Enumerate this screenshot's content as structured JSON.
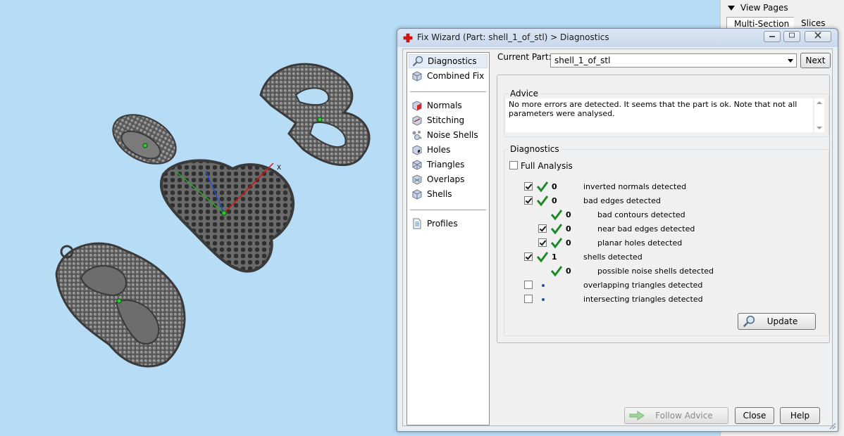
{
  "background_panel": {
    "view_pages_label": "View Pages",
    "tabs": [
      "Multi-Section",
      "Slices"
    ]
  },
  "dialog": {
    "title": "Fix Wizard (Part: shell_1_of_stl) > Diagnostics",
    "nav_items": [
      {
        "label": "Diagnostics",
        "icon": "magnifier-icon"
      },
      {
        "label": "Combined Fix",
        "icon": "cube-icon"
      },
      {
        "label": "Normals",
        "icon": "normals-cube-icon"
      },
      {
        "label": "Stitching",
        "icon": "stitching-cube-icon"
      },
      {
        "label": "Noise Shells",
        "icon": "noise-shells-icon"
      },
      {
        "label": "Holes",
        "icon": "holes-cube-icon"
      },
      {
        "label": "Triangles",
        "icon": "triangles-cube-icon"
      },
      {
        "label": "Overlaps",
        "icon": "overlaps-cube-icon"
      },
      {
        "label": "Shells",
        "icon": "shells-cube-icon"
      },
      {
        "label": "Profiles",
        "icon": "document-icon"
      }
    ],
    "current_part_label": "Current Part:",
    "current_part_value": "shell_1_of_stl",
    "next_label": "Next",
    "advice_title": "Advice",
    "advice_text": "No more errors are detected. It seems that the part is ok. Note that not all parameters were analysed.",
    "diagnostics_title": "Diagnostics",
    "full_analysis_label": "Full Analysis",
    "rows": [
      {
        "checkbox": true,
        "checked": true,
        "status": "check",
        "count": "0",
        "label": "inverted normals detected",
        "indent": 0
      },
      {
        "checkbox": true,
        "checked": true,
        "status": "check",
        "count": "0",
        "label": "bad edges detected",
        "indent": 0
      },
      {
        "checkbox": false,
        "checked": false,
        "status": "check",
        "count": "0",
        "label": "bad contours detected",
        "indent": 1
      },
      {
        "checkbox": true,
        "checked": true,
        "status": "check",
        "count": "0",
        "label": "near bad edges detected",
        "indent": 1
      },
      {
        "checkbox": true,
        "checked": true,
        "status": "check",
        "count": "0",
        "label": "planar holes detected",
        "indent": 1
      },
      {
        "checkbox": true,
        "checked": true,
        "status": "check",
        "count": "1",
        "label": "shells detected",
        "indent": 0
      },
      {
        "checkbox": false,
        "checked": false,
        "status": "check",
        "count": "0",
        "label": "possible noise shells detected",
        "indent": 1
      },
      {
        "checkbox": true,
        "checked": false,
        "status": "dot",
        "count": "",
        "label": "overlapping triangles detected",
        "indent": 0
      },
      {
        "checkbox": true,
        "checked": false,
        "status": "dot",
        "count": "",
        "label": "intersecting triangles detected",
        "indent": 0
      }
    ],
    "update_label": "Update",
    "follow_advice_label": "Follow Advice",
    "close_label": "Close",
    "help_label": "Help"
  },
  "viewport": {
    "axis_x_label": "x",
    "colors": {
      "background": "#b7dcf5",
      "model": "#5d5d5d",
      "axis_x": "#e01010",
      "axis_y": "#2aa82a",
      "axis_z": "#1f4fd6"
    }
  }
}
